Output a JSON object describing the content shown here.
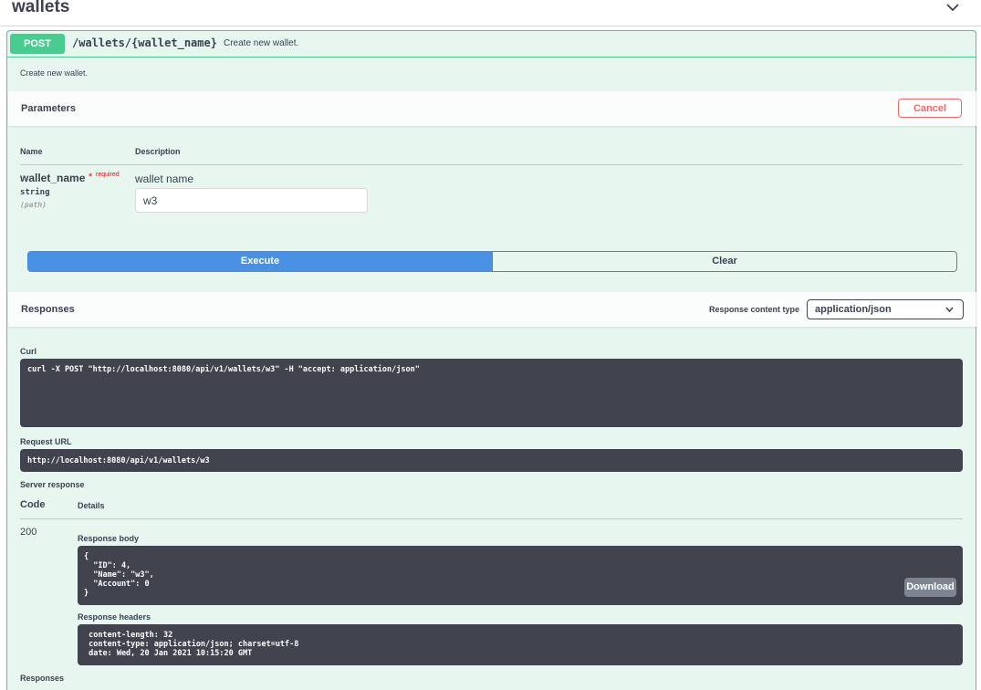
{
  "tag": {
    "title": "wallets",
    "chevron_icon": "chevron-down-icon"
  },
  "operation": {
    "method": "POST",
    "path": "/wallets/{wallet_name}",
    "summary": "Create new wallet.",
    "description": "Create new wallet.",
    "colors": {
      "method": "#49cc90",
      "background": "#e8f6f0"
    }
  },
  "parameters": {
    "title": "Parameters",
    "cancel_label": "Cancel",
    "col_name": "Name",
    "col_description": "Description",
    "items": [
      {
        "name": "wallet_name",
        "required_star": "*",
        "required_label": "required",
        "type": "string",
        "in": "(path)",
        "description": "wallet name",
        "value": "w3"
      }
    ]
  },
  "actions": {
    "execute_label": "Execute",
    "clear_label": "Clear"
  },
  "responses": {
    "title": "Responses",
    "content_type_label": "Response content type",
    "content_type_value": "application/json",
    "curl_label": "Curl",
    "curl": "curl -X POST \"http://localhost:8080/api/v1/wallets/w3\" -H \"accept: application/json\"",
    "request_url_label": "Request URL",
    "request_url": "http://localhost:8080/api/v1/wallets/w3",
    "server_response_label": "Server response",
    "col_code": "Code",
    "col_details": "Details",
    "code": "200",
    "body_label": "Response body",
    "body": "{\n  \"ID\": 4,\n  \"Name\": \"w3\",\n  \"Account\": 0\n}",
    "download_label": "Download",
    "headers_label": "Response headers",
    "headers": " content-length: 32 \n content-type: application/json; charset=utf-8 \n date: Wed, 20 Jan 2021 10:15:20 GMT ",
    "footer_label": "Responses"
  }
}
